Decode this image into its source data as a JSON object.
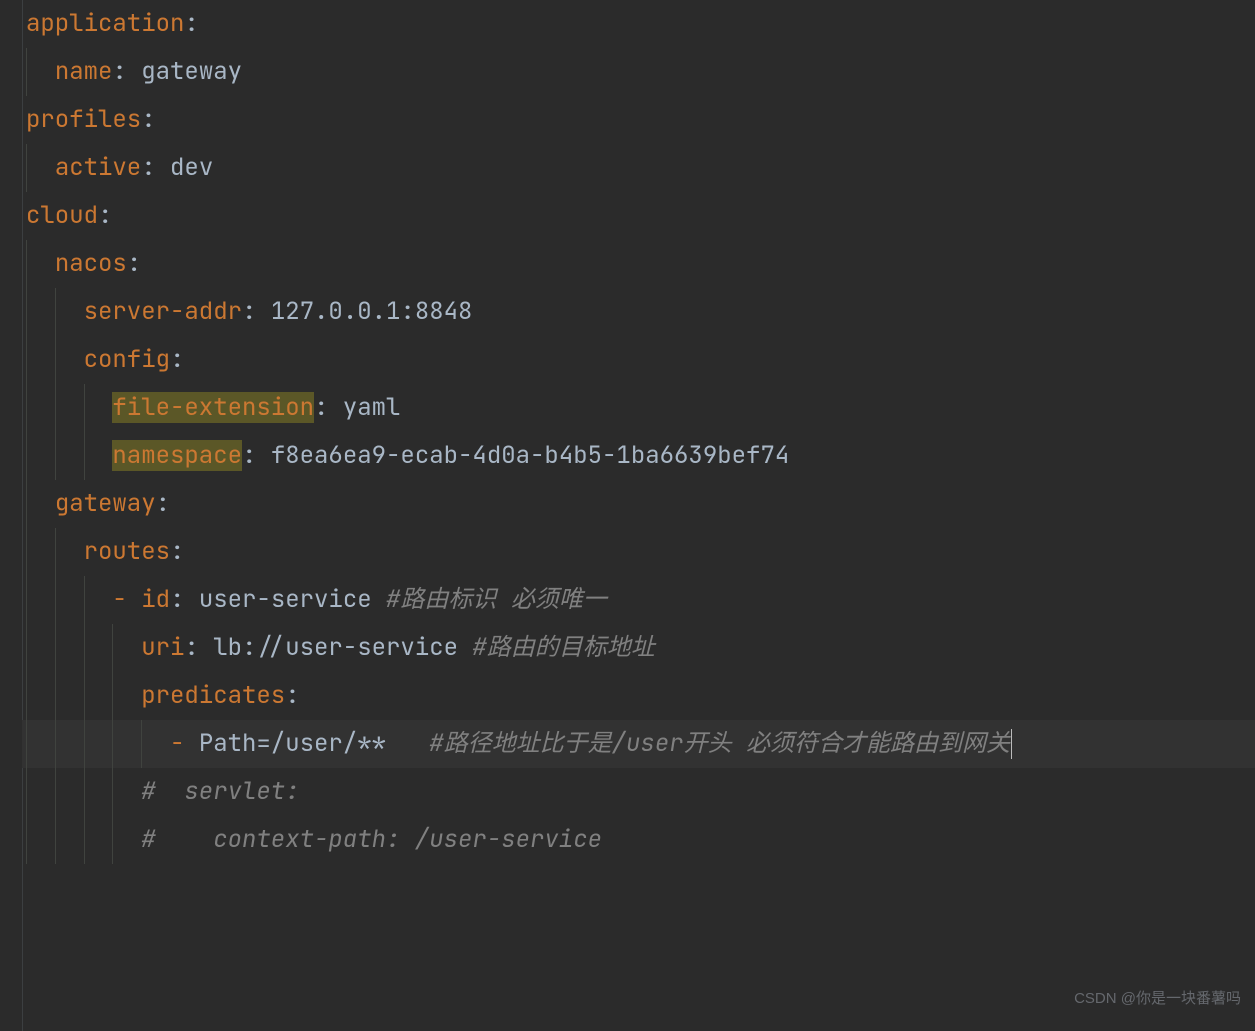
{
  "watermark": "CSDN @你是一块番薯吗",
  "lines": [
    {
      "indent": 0,
      "segs": [
        {
          "cls": "key",
          "t": "application"
        },
        {
          "cls": "val",
          "t": ":"
        }
      ],
      "guides": []
    },
    {
      "indent": 1,
      "segs": [
        {
          "cls": "key",
          "t": "name"
        },
        {
          "cls": "val",
          "t": ": gateway"
        }
      ],
      "guides": [
        0
      ]
    },
    {
      "indent": 0,
      "segs": [
        {
          "cls": "key",
          "t": "profiles"
        },
        {
          "cls": "val",
          "t": ":"
        }
      ],
      "guides": []
    },
    {
      "indent": 1,
      "segs": [
        {
          "cls": "key",
          "t": "active"
        },
        {
          "cls": "val",
          "t": ": dev"
        }
      ],
      "guides": [
        0
      ]
    },
    {
      "indent": 0,
      "segs": [
        {
          "cls": "key",
          "t": "cloud"
        },
        {
          "cls": "val",
          "t": ":"
        }
      ],
      "guides": []
    },
    {
      "indent": 1,
      "segs": [
        {
          "cls": "key",
          "t": "nacos"
        },
        {
          "cls": "val",
          "t": ":"
        }
      ],
      "guides": [
        0
      ]
    },
    {
      "indent": 2,
      "segs": [
        {
          "cls": "key",
          "t": "server-addr"
        },
        {
          "cls": "val",
          "t": ": 127.0.0.1:8848"
        }
      ],
      "guides": [
        0,
        1
      ]
    },
    {
      "indent": 2,
      "segs": [
        {
          "cls": "key",
          "t": "config"
        },
        {
          "cls": "val",
          "t": ":"
        }
      ],
      "guides": [
        0,
        1
      ]
    },
    {
      "indent": 3,
      "segs": [
        {
          "cls": "key hl",
          "t": "file-extension"
        },
        {
          "cls": "val",
          "t": ": yaml"
        }
      ],
      "guides": [
        0,
        1,
        2
      ]
    },
    {
      "indent": 3,
      "segs": [
        {
          "cls": "key hl",
          "t": "namespace"
        },
        {
          "cls": "val",
          "t": ": f8ea6ea9-ecab-4d0a-b4b5-1ba6639bef74"
        }
      ],
      "guides": [
        0,
        1,
        2
      ]
    },
    {
      "indent": 1,
      "segs": [
        {
          "cls": "key",
          "t": "gateway"
        },
        {
          "cls": "val",
          "t": ":"
        }
      ],
      "guides": [
        0
      ]
    },
    {
      "indent": 2,
      "segs": [
        {
          "cls": "key",
          "t": "routes"
        },
        {
          "cls": "val",
          "t": ":"
        }
      ],
      "guides": [
        0,
        1
      ]
    },
    {
      "indent": 3,
      "segs": [
        {
          "cls": "dash",
          "t": "- "
        },
        {
          "cls": "key",
          "t": "id"
        },
        {
          "cls": "val",
          "t": ": user-service "
        },
        {
          "cls": "comment",
          "t": "#路由标识 必须唯一"
        }
      ],
      "guides": [
        0,
        1,
        2
      ]
    },
    {
      "indent": 4,
      "segs": [
        {
          "cls": "key",
          "t": "uri"
        },
        {
          "cls": "val",
          "t": ": lb://user-service "
        },
        {
          "cls": "comment",
          "t": "#路由的目标地址"
        }
      ],
      "guides": [
        0,
        1,
        2,
        3
      ]
    },
    {
      "indent": 4,
      "segs": [
        {
          "cls": "key",
          "t": "predicates"
        },
        {
          "cls": "val",
          "t": ":"
        }
      ],
      "guides": [
        0,
        1,
        2,
        3
      ]
    },
    {
      "indent": 5,
      "segs": [
        {
          "cls": "dash",
          "t": "- "
        },
        {
          "cls": "val",
          "t": "Path=/user/**   "
        },
        {
          "cls": "comment",
          "t": "#路径地址比于是/user开头 必须符合才能路由到网关"
        }
      ],
      "guides": [
        0,
        1,
        2,
        3,
        4
      ],
      "cursor": true,
      "cursorline": true
    },
    {
      "indent": 4,
      "segs": [
        {
          "cls": "comment",
          "t": "#  servlet:"
        }
      ],
      "guides": [
        0,
        1,
        2,
        3
      ]
    },
    {
      "indent": 4,
      "segs": [
        {
          "cls": "comment",
          "t": "#    context-path: /user-service"
        }
      ],
      "guides": [
        0,
        1,
        2,
        3
      ]
    }
  ],
  "indent_unit": 2
}
